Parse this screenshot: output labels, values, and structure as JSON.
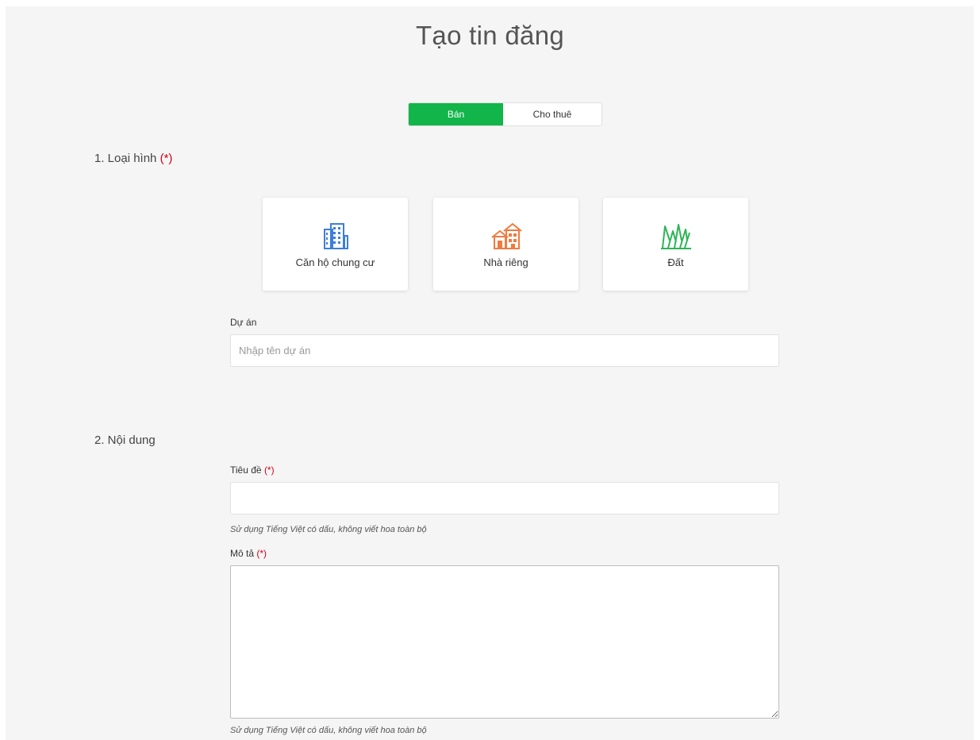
{
  "page": {
    "title": "Tạo tin đăng"
  },
  "mode_toggle": {
    "options": [
      {
        "label": "Bán",
        "selected": true
      },
      {
        "label": "Cho thuê",
        "selected": false
      }
    ],
    "active_color": "#12b54a"
  },
  "section1": {
    "title": "1. Loại hình",
    "required_mark": "(*)",
    "property_types": [
      {
        "label": "Căn hộ chung cư",
        "icon": "apartment-building-icon",
        "color": "#3d7edb"
      },
      {
        "label": "Nhà riêng",
        "icon": "house-icon",
        "color": "#f07b3f"
      },
      {
        "label": "Đất",
        "icon": "grass-land-icon",
        "color": "#2fb457"
      }
    ],
    "project": {
      "label": "Dự án",
      "placeholder": "Nhập tên dự án",
      "value": ""
    }
  },
  "section2": {
    "title": "2. Nội dung",
    "title_field": {
      "label": "Tiêu đề",
      "required_mark": "(*)",
      "value": "",
      "hint": "Sử dụng Tiếng Việt có dấu, không viết hoa toàn bộ"
    },
    "description_field": {
      "label": "Mô tả",
      "required_mark": "(*)",
      "value": "",
      "hint": "Sử dụng Tiếng Việt có dấu, không viết hoa toàn bộ"
    }
  }
}
